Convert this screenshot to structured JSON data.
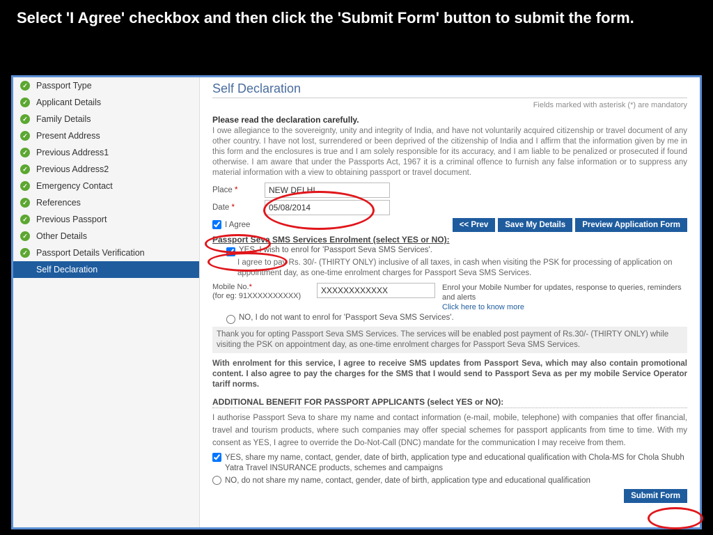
{
  "instruction": "Select 'I Agree' checkbox and then click the 'Submit Form' button to submit the form.",
  "sidebar": {
    "items": [
      {
        "label": "Passport Type"
      },
      {
        "label": "Applicant Details"
      },
      {
        "label": "Family Details"
      },
      {
        "label": "Present Address"
      },
      {
        "label": "Previous Address1"
      },
      {
        "label": "Previous Address2"
      },
      {
        "label": "Emergency Contact"
      },
      {
        "label": "References"
      },
      {
        "label": "Previous Passport"
      },
      {
        "label": "Other Details"
      },
      {
        "label": "Passport Details Verification"
      },
      {
        "label": "Self Declaration"
      }
    ]
  },
  "main": {
    "title": "Self Declaration",
    "mandatory": "Fields marked with asterisk (*) are mandatory",
    "decl_head": "Please read the declaration carefully.",
    "decl_text": "I owe allegiance to the sovereignty, unity and integrity of India, and have not voluntarily acquired citizenship or travel document of any other country. I have not lost, surrendered or been deprived of the citizenship of India and I affirm that the information given by me in this form and the enclosures is true and I am solely responsible for its accuracy, and I am liable to be penalized or prosecuted if found otherwise. I am aware that under the Passports Act, 1967 it is a criminal offence to furnish any false information or to suppress any material information with a view to obtaining passport or travel document.",
    "place_label": "Place",
    "place_value": "NEW DELHI",
    "date_label": "Date",
    "date_value": "05/08/2014",
    "agree_label": "I Agree",
    "btn_prev": "<< Prev",
    "btn_save": "Save My Details",
    "btn_preview": "Preview Application Form",
    "sms_head": "Passport Seva SMS Services Enrolment (select YES or NO):",
    "sms_yes": "YES, I wish to enrol for 'Passport Seva SMS Services'.",
    "sms_agree": "I agree to pay Rs. 30/- (THIRTY ONLY) inclusive of all taxes, in cash when visiting the PSK for processing of application on appointment day, as one-time enrolment charges for Passport Seva SMS Services.",
    "mobile_label": "Mobile No.",
    "mobile_eg": "(for eg: 91XXXXXXXXXX)",
    "mobile_value": "XXXXXXXXXXXX",
    "mobile_side": "Enrol your Mobile Number for updates, response to queries, reminders and alerts",
    "mobile_link": "Click here to know more",
    "sms_no": "NO, I do not want to enrol for 'Passport Seva SMS Services'.",
    "info_box": "Thank you for opting Passport Seva SMS Services. The services will be enabled post payment of Rs.30/- (THIRTY ONLY) while visiting the PSK on appointment day, as one-time enrolment charges for Passport Seva SMS Services.",
    "bold_para": "With enrolment for this service, I agree to receive SMS updates from Passport Seva, which may also contain promotional content. I also agree to pay the charges for the SMS that I would send to Passport Seva as per my mobile Service Operator tariff norms.",
    "add_head": "ADDITIONAL BENEFIT FOR PASSPORT APPLICANTS (select YES or NO):",
    "auth_text": "I authorise Passport Seva to share my name and contact information (e-mail, mobile, telephone) with companies that offer financial, travel and tourism products, where such companies may offer special schemes for passport applicants from time to time. With my consent as YES, I agree to override the Do-Not-Call (DNC) mandate for the communication I may receive from them.",
    "add_yes": "YES, share my name, contact, gender, date of birth, application type and educational qualification with Chola-MS for Chola Shubh Yatra Travel INSURANCE products, schemes and campaigns",
    "add_no": "NO, do not share my name, contact, gender, date of birth, application type and educational qualification",
    "submit": "Submit Form"
  }
}
